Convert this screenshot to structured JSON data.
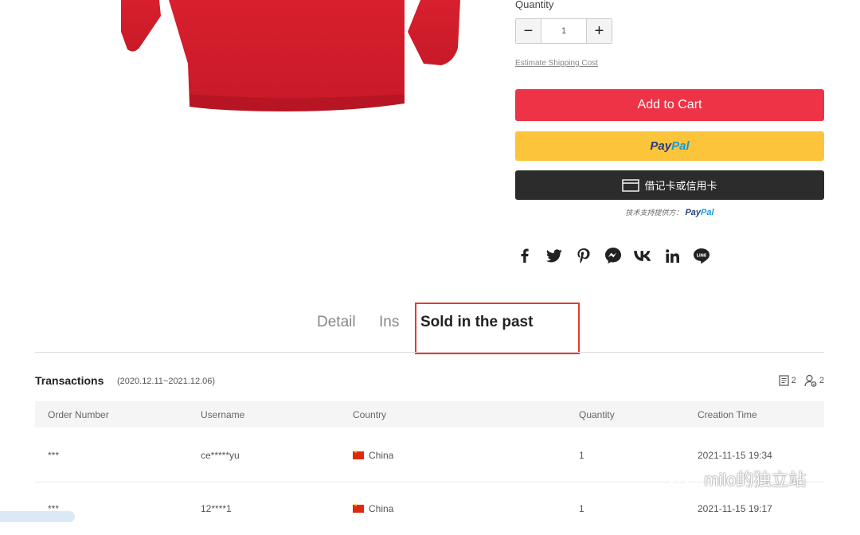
{
  "product": {
    "quantity_label": "Quantity",
    "quantity_value": "1",
    "minus_symbol": "−",
    "plus_symbol": "+",
    "shipping_link": "Estimate Shipping Cost",
    "add_to_cart": "Add to Cart",
    "paypal_logo_part1": "Pay",
    "paypal_logo_part2": "Pal",
    "card_button": "借记卡或信用卡",
    "powered_by": "技术支持提供方：",
    "brand_color": "#ee3346",
    "paypal_color": "#fcc43b"
  },
  "share": [
    "facebook-icon",
    "twitter-icon",
    "pinterest-icon",
    "messenger-icon",
    "vk-icon",
    "linkedin-icon",
    "line-icon"
  ],
  "tabs": [
    {
      "label": "Detail"
    },
    {
      "label": "Ins"
    },
    {
      "label": "Sold in the past",
      "active": true
    }
  ],
  "transactions": {
    "title": "Transactions",
    "range": "(2020.12.11~2021.12.06)",
    "orders_count": "2",
    "buyers_count": "2",
    "columns": [
      "Order Number",
      "Username",
      "Country",
      "Quantity",
      "Creation Time"
    ],
    "rows": [
      {
        "order": "***",
        "user": "ce*****yu",
        "country": "China",
        "qty": "1",
        "time": "2021-11-15 19:34"
      },
      {
        "order": "***",
        "user": "12****1",
        "country": "China",
        "qty": "1",
        "time": "2021-11-15 19:17"
      }
    ]
  },
  "watermark": "milo的独立站"
}
